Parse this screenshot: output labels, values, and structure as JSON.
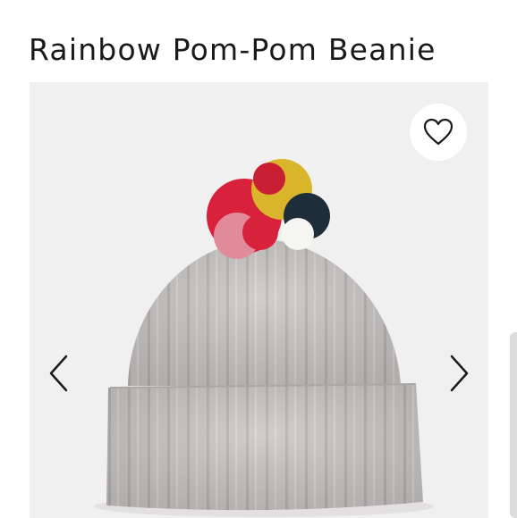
{
  "product": {
    "title": "Rainbow Pom-Pom Beanie"
  },
  "gallery": {
    "favorite_icon": "heart-icon",
    "prev_icon": "chevron-left-icon",
    "next_icon": "chevron-right-icon",
    "image_subject": "beanie-photo"
  },
  "colors": {
    "background": "#f1f0f0",
    "beanie": "#c9c6c5",
    "pompom_red": "#d8213a",
    "pompom_yellow": "#d8b52a",
    "pompom_navy": "#1e2d3a",
    "pompom_pink": "#e08a9a",
    "pompom_white": "#f5f5f2"
  }
}
